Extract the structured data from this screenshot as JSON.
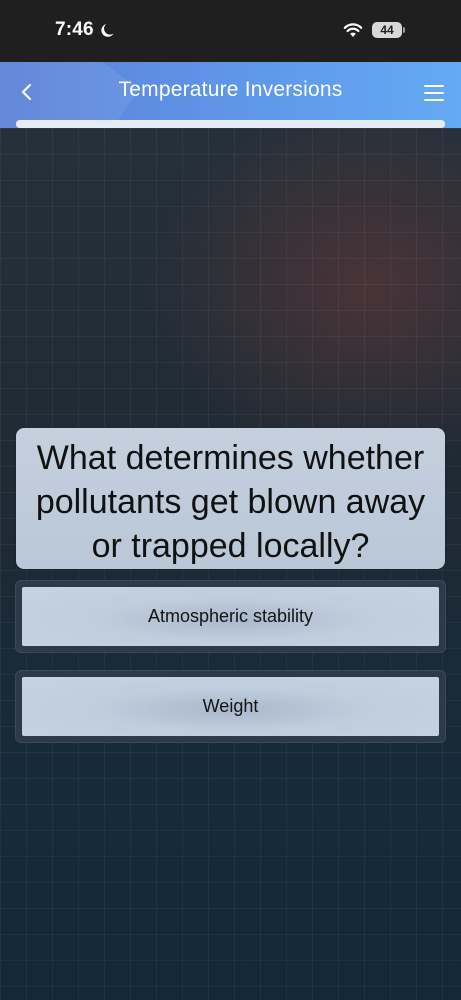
{
  "status_bar": {
    "time": "7:46",
    "battery": "44"
  },
  "header": {
    "title": "Temperature Inversions",
    "progress_fraction": 1.0
  },
  "question": {
    "text": "What determines whether pollutants get blown away or trapped locally?"
  },
  "answers": [
    {
      "label": "Atmospheric stability"
    },
    {
      "label": "Weight"
    }
  ],
  "icons": {
    "status": [
      "moon-icon",
      "wifi-icon",
      "battery-icon"
    ],
    "header": [
      "back-chevron-icon",
      "hamburger-menu-icon"
    ]
  },
  "colors": {
    "header_gradient_start": "#5a7fd6",
    "header_gradient_end": "#64aaf4",
    "card_background": "#c5d0de",
    "page_background": "#1c2a35"
  }
}
